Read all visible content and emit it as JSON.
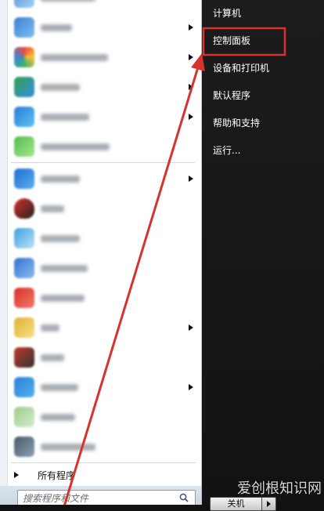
{
  "start_menu": {
    "programs": [
      {
        "icon": "program-icon",
        "colors": [
          "#4a8fd8",
          "#a9d2f5"
        ],
        "submenu": false
      },
      {
        "icon": "program-icon",
        "colors": [
          "#3b7fd4",
          "#7fc0f0"
        ],
        "submenu": true
      },
      {
        "icon": "pinwheel-icon",
        "colors": [
          "#e84c3d",
          "#f7c331",
          "#3cb371",
          "#3a86d8"
        ],
        "submenu": true
      },
      {
        "icon": "program-icon",
        "colors": [
          "#2f9e4f",
          "#3a8fe0"
        ],
        "submenu": true
      },
      {
        "icon": "program-icon",
        "colors": [
          "#2a7fd6",
          "#5cc0f0"
        ],
        "submenu": true
      },
      {
        "icon": "program-icon",
        "colors": [
          "#4fbf4f",
          "#a9e48f"
        ],
        "submenu": false
      },
      {
        "icon": "program-icon",
        "colors": [
          "#1e6fd0",
          "#5aaef0"
        ],
        "submenu": true
      },
      {
        "icon": "qq-penguin-icon",
        "colors": [
          "#d9312a",
          "#222222"
        ],
        "submenu": false
      },
      {
        "icon": "program-icon",
        "colors": [
          "#3aa0e0",
          "#bfe3f7"
        ],
        "submenu": false
      },
      {
        "icon": "program-icon",
        "colors": [
          "#2f74d0",
          "#8dbaf0"
        ],
        "submenu": false
      },
      {
        "icon": "program-icon",
        "colors": [
          "#d8302a",
          "#f07a6a"
        ],
        "submenu": false
      },
      {
        "icon": "program-icon",
        "colors": [
          "#e0b030",
          "#f7e08a"
        ],
        "submenu": true
      },
      {
        "icon": "program-icon",
        "colors": [
          "#c0392b",
          "#333333"
        ],
        "submenu": false
      },
      {
        "icon": "program-icon",
        "colors": [
          "#2f7fd8",
          "#4fb0e8"
        ],
        "submenu": true
      },
      {
        "icon": "program-icon",
        "colors": [
          "#9ccc8a",
          "#d8ecd0"
        ],
        "submenu": false
      },
      {
        "icon": "program-icon",
        "colors": [
          "#4a5a6a",
          "#8aa0b4"
        ],
        "submenu": false
      }
    ],
    "all_programs_label": "所有程序",
    "search": {
      "placeholder": "搜索程序和文件"
    },
    "right_items": [
      {
        "label": "计算机"
      },
      {
        "label": "控制面板",
        "highlighted": true
      },
      {
        "label": "设备和打印机"
      },
      {
        "label": "默认程序"
      },
      {
        "label": "帮助和支持"
      },
      {
        "label": "运行..."
      }
    ],
    "shutdown_label": "关机"
  },
  "annotation": {
    "highlight_color": "#d9322e"
  },
  "watermark": "爱创根知识网"
}
